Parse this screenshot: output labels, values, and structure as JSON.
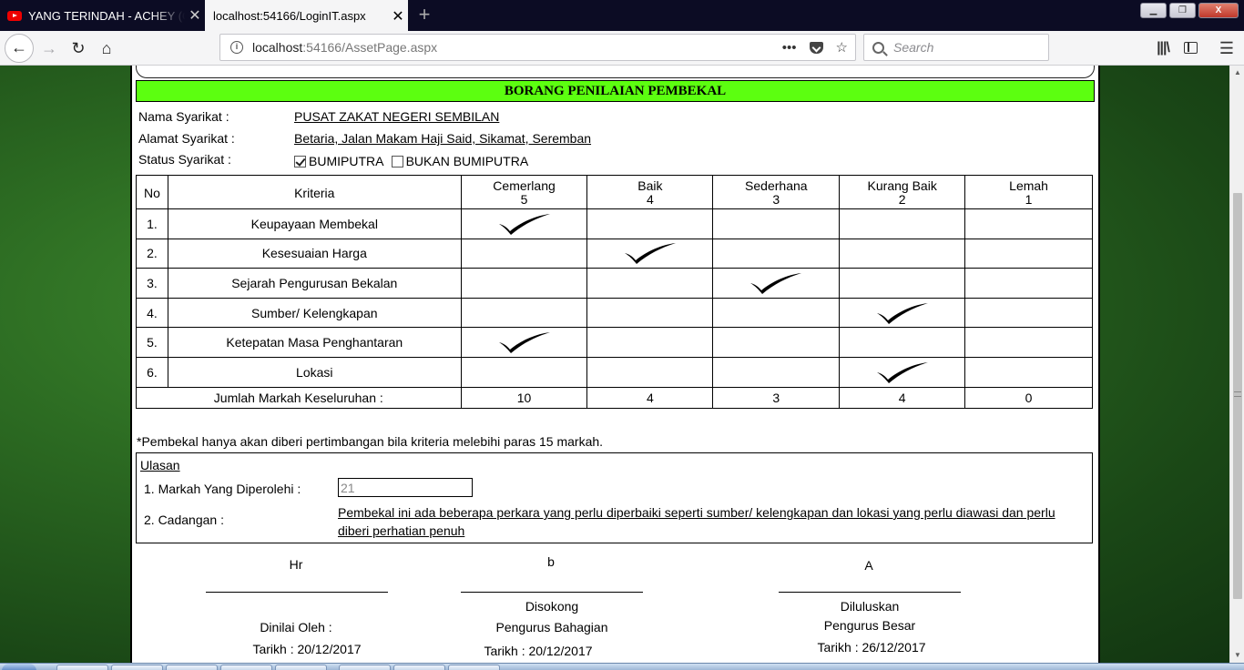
{
  "browser": {
    "tabs": [
      {
        "title": "YANG TERINDAH - ACHEY (Official",
        "active": false,
        "icon": "youtube-icon"
      },
      {
        "title": "localhost:54166/LoginIT.aspx",
        "active": true
      }
    ],
    "tab_close_glyph": "✕",
    "new_tab_glyph": "+",
    "window_buttons": {
      "minimize": "▁",
      "maximize": "❐",
      "close": "X"
    },
    "nav": {
      "back": "←",
      "forward": "→",
      "reload": "↻",
      "home": "⌂"
    },
    "url": {
      "host": "localhost",
      "rest": ":54166/AssetPage.aspx"
    },
    "url_actions": {
      "more": "•••",
      "bookmark": "☆"
    },
    "search_placeholder": "Search",
    "tools": {
      "library": "|||\\",
      "menu": "☰"
    }
  },
  "form": {
    "title": "BORANG PENILAIAN PEMBEKAL",
    "nama_label": "Nama Syarikat :",
    "nama_value": "PUSAT ZAKAT NEGERI SEMBILAN",
    "alamat_label": "Alamat Syarikat :",
    "alamat_value": "Betaria, Jalan Makam Haji Said, Sikamat, Seremban",
    "status_label": "Status Syarikat :",
    "status_options": [
      {
        "label": "BUMIPUTRA",
        "checked": true
      },
      {
        "label": "BUKAN BUMIPUTRA",
        "checked": false
      }
    ],
    "table": {
      "col_no": "No",
      "col_kriteria": "Kriteria",
      "ratings": [
        {
          "label": "Cemerlang",
          "score": "5"
        },
        {
          "label": "Baik",
          "score": "4"
        },
        {
          "label": "Sederhana",
          "score": "3"
        },
        {
          "label": "Kurang Baik",
          "score": "2"
        },
        {
          "label": "Lemah",
          "score": "1"
        }
      ],
      "rows": [
        {
          "no": "1.",
          "kriteria": "Keupayaan Membekal",
          "rating_index": 0
        },
        {
          "no": "2.",
          "kriteria": "Kesesuaian Harga",
          "rating_index": 1
        },
        {
          "no": "3.",
          "kriteria": "Sejarah Pengurusan Bekalan",
          "rating_index": 2
        },
        {
          "no": "4.",
          "kriteria": "Sumber/ Kelengkapan",
          "rating_index": 3
        },
        {
          "no": "5.",
          "kriteria": "Ketepatan Masa Penghantaran",
          "rating_index": 0
        },
        {
          "no": "6.",
          "kriteria": "Lokasi",
          "rating_index": 3
        }
      ],
      "total_label": "Jumlah Markah Keseluruhan :",
      "totals": [
        "10",
        "4",
        "3",
        "4",
        "0"
      ]
    },
    "note": "*Pembekal hanya akan diberi pertimbangan bila kriteria melebihi paras 15 markah.",
    "ulasan": {
      "title": "Ulasan",
      "markah_label": "1. Markah Yang Diperolehi :",
      "markah_value": "21",
      "cadangan_label": "2. Cadangan :",
      "cadangan_value": "Pembekal ini ada beberapa perkara yang perlu diperbaiki seperti sumber/ kelengkapan dan lokasi yang perlu diawasi dan perlu diberi perhatian penuh"
    },
    "signatures": [
      {
        "name": "Hr",
        "line1": "Dinilai Oleh :",
        "line2": "",
        "date": "Tarikh : 20/12/2017"
      },
      {
        "name": "b",
        "line1": "Disokong",
        "line2": "Pengurus Bahagian",
        "date": "Tarikh : 20/12/2017"
      },
      {
        "name": "A",
        "line1": "Diluluskan",
        "line2": "Pengurus Besar",
        "date": "Tarikh : 26/12/2017"
      }
    ]
  },
  "colors": {
    "title_bar_bg": "#5cff10",
    "header_bar": "#14a84a",
    "page_bg": "#2c6b22",
    "tab_strip": "#0c0c24"
  }
}
